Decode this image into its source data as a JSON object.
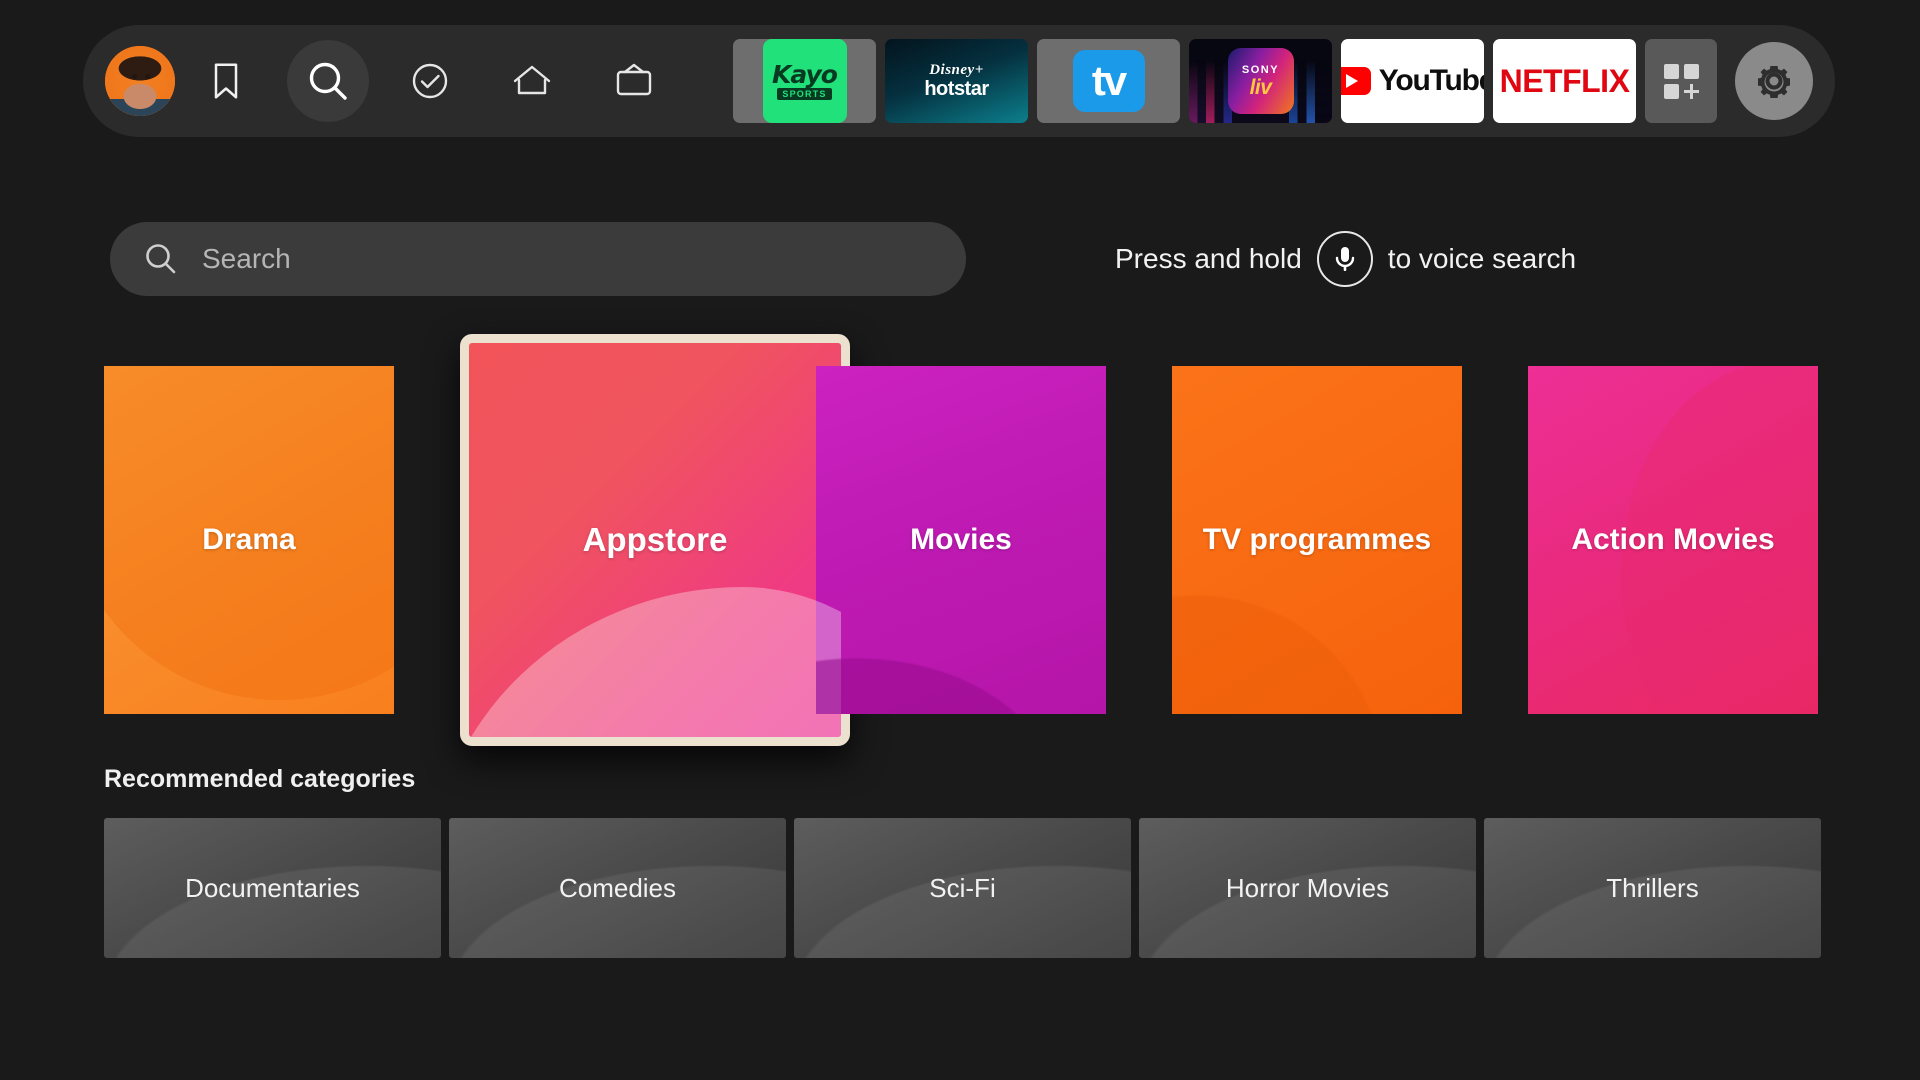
{
  "topbar": {
    "avatar": {
      "name": "profile-avatar",
      "alt": "User profile picture"
    },
    "nav_icons": [
      {
        "name": "bookmark-icon",
        "label": "Bookmarks",
        "active": false
      },
      {
        "name": "search-icon",
        "label": "Search",
        "active": true
      },
      {
        "name": "check-circle-icon",
        "label": "Watchlist",
        "active": false
      },
      {
        "name": "home-icon",
        "label": "Home",
        "active": false
      },
      {
        "name": "live-tv-icon",
        "label": "Live TV",
        "active": false
      }
    ],
    "apps": [
      {
        "name": "kayo-sports",
        "label": "Kayo",
        "sublabel": "SPORTS"
      },
      {
        "name": "disney-hotstar",
        "label": "Disney+",
        "sublabel": "hotstar"
      },
      {
        "name": "apple-tv",
        "label": "tv"
      },
      {
        "name": "sony-liv",
        "label": "SONY",
        "sublabel": "liv"
      },
      {
        "name": "youtube",
        "label": "YouTube"
      },
      {
        "name": "netflix",
        "label": "NETFLIX"
      }
    ],
    "apps_grid_label": "All apps",
    "settings_label": "Settings"
  },
  "search": {
    "placeholder": "Search",
    "voice_hint_before": "Press and hold",
    "voice_hint_after": "to voice search"
  },
  "tiles": [
    {
      "name": "tile-drama",
      "label": "Drama",
      "color": "#f98b2a",
      "focused": false
    },
    {
      "name": "tile-appstore",
      "label": "Appstore",
      "color": "#f0545e",
      "focused": true
    },
    {
      "name": "tile-movies",
      "label": "Movies",
      "color": "#c01bb5",
      "focused": false
    },
    {
      "name": "tile-tv-programmes",
      "label": "TV programmes",
      "color": "#f86a12",
      "focused": false
    },
    {
      "name": "tile-action-movies",
      "label": "Action Movies",
      "color": "#ea2a7f",
      "focused": false
    }
  ],
  "recommended": {
    "title": "Recommended categories",
    "items": [
      {
        "name": "category-documentaries",
        "label": "Documentaries"
      },
      {
        "name": "category-comedies",
        "label": "Comedies"
      },
      {
        "name": "category-sci-fi",
        "label": "Sci-Fi"
      },
      {
        "name": "category-horror-movies",
        "label": "Horror Movies"
      },
      {
        "name": "category-thrillers",
        "label": "Thrillers"
      }
    ]
  },
  "colors": {
    "background": "#1a1a1a",
    "topbar": "#2b2b2b",
    "searchbar": "#3b3b3b",
    "focus_border": "#ece0cf",
    "text": "#f2f2f2"
  }
}
